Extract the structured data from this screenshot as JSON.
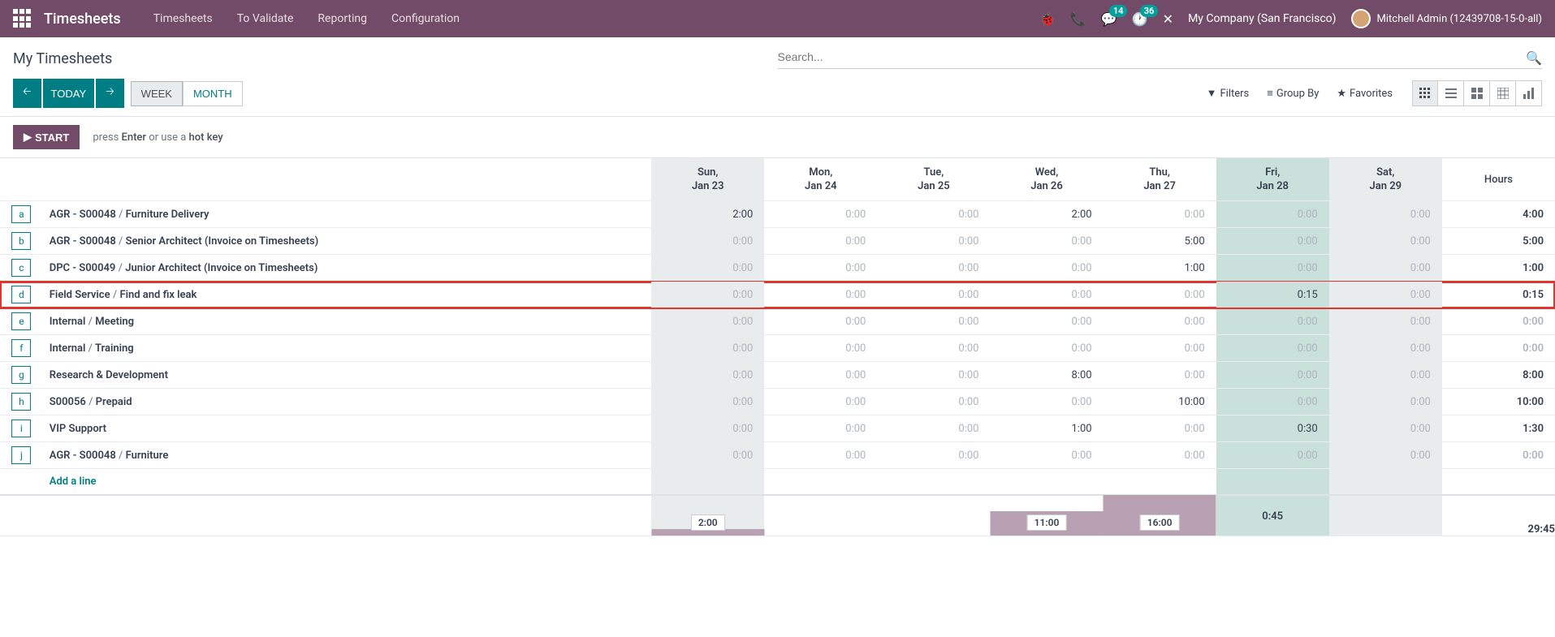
{
  "nav": {
    "brand": "Timesheets",
    "menu": [
      "Timesheets",
      "To Validate",
      "Reporting",
      "Configuration"
    ],
    "messaging_badge": "14",
    "activities_badge": "36",
    "company": "My Company (San Francisco)",
    "user": "Mitchell Admin (12439708-15-0-all)"
  },
  "breadcrumb": "My Timesheets",
  "search": {
    "placeholder": "Search..."
  },
  "today": "TODAY",
  "scales": {
    "week": "WEEK",
    "month": "MONTH"
  },
  "filters": "Filters",
  "groupby": "Group By",
  "favorites": "Favorites",
  "start": "START",
  "hint_prefix": "press ",
  "hint_enter": "Enter",
  "hint_mid": " or use a ",
  "hint_hotkey": "hot key",
  "days": [
    {
      "dow": "Sun,",
      "date": "Jan 23",
      "cls": "col-sun"
    },
    {
      "dow": "Mon,",
      "date": "Jan 24",
      "cls": ""
    },
    {
      "dow": "Tue,",
      "date": "Jan 25",
      "cls": ""
    },
    {
      "dow": "Wed,",
      "date": "Jan 26",
      "cls": ""
    },
    {
      "dow": "Thu,",
      "date": "Jan 27",
      "cls": ""
    },
    {
      "dow": "Fri,",
      "date": "Jan 28",
      "cls": "col-fri"
    },
    {
      "dow": "Sat,",
      "date": "Jan 29",
      "cls": "col-sat"
    }
  ],
  "hours_header": "Hours",
  "rows": [
    {
      "key": "a",
      "p1": "AGR - S00048",
      "p2": "Furniture Delivery",
      "cells": [
        "2:00",
        "0:00",
        "0:00",
        "2:00",
        "0:00",
        "0:00",
        "0:00"
      ],
      "total": "4:00",
      "hl": false
    },
    {
      "key": "b",
      "p1": "AGR - S00048",
      "p2": "Senior Architect (Invoice on Timesheets)",
      "cells": [
        "0:00",
        "0:00",
        "0:00",
        "0:00",
        "5:00",
        "0:00",
        "0:00"
      ],
      "total": "5:00",
      "hl": false
    },
    {
      "key": "c",
      "p1": "DPC - S00049",
      "p2": "Junior Architect (Invoice on Timesheets)",
      "cells": [
        "0:00",
        "0:00",
        "0:00",
        "0:00",
        "1:00",
        "0:00",
        "0:00"
      ],
      "total": "1:00",
      "hl": false
    },
    {
      "key": "d",
      "p1": "Field Service",
      "p2": "Find and fix leak",
      "cells": [
        "0:00",
        "0:00",
        "0:00",
        "0:00",
        "0:00",
        "0:15",
        "0:00"
      ],
      "total": "0:15",
      "hl": true
    },
    {
      "key": "e",
      "p1": "Internal",
      "p2": "Meeting",
      "cells": [
        "0:00",
        "0:00",
        "0:00",
        "0:00",
        "0:00",
        "0:00",
        "0:00"
      ],
      "total": "0:00",
      "hl": false
    },
    {
      "key": "f",
      "p1": "Internal",
      "p2": "Training",
      "cells": [
        "0:00",
        "0:00",
        "0:00",
        "0:00",
        "0:00",
        "0:00",
        "0:00"
      ],
      "total": "0:00",
      "hl": false
    },
    {
      "key": "g",
      "p1": "Research & Development",
      "p2": "",
      "cells": [
        "0:00",
        "0:00",
        "0:00",
        "8:00",
        "0:00",
        "0:00",
        "0:00"
      ],
      "total": "8:00",
      "hl": false
    },
    {
      "key": "h",
      "p1": "S00056",
      "p2": "Prepaid",
      "cells": [
        "0:00",
        "0:00",
        "0:00",
        "0:00",
        "10:00",
        "0:00",
        "0:00"
      ],
      "total": "10:00",
      "hl": false
    },
    {
      "key": "i",
      "p1": "VIP Support",
      "p2": "",
      "cells": [
        "0:00",
        "0:00",
        "0:00",
        "1:00",
        "0:00",
        "0:30",
        "0:00"
      ],
      "total": "1:30",
      "hl": false
    },
    {
      "key": "j",
      "p1": "AGR - S00048",
      "p2": "Furniture",
      "cells": [
        "0:00",
        "0:00",
        "0:00",
        "0:00",
        "0:00",
        "0:00",
        "0:00"
      ],
      "total": "0:00",
      "hl": false
    }
  ],
  "add_line": "Add a line",
  "footer": {
    "cells": [
      {
        "val": "2:00",
        "h": 8,
        "boxed": true
      },
      {
        "val": "",
        "h": 0,
        "boxed": false
      },
      {
        "val": "",
        "h": 0,
        "boxed": false
      },
      {
        "val": "11:00",
        "h": 30,
        "boxed": true
      },
      {
        "val": "16:00",
        "h": 50,
        "boxed": true
      },
      {
        "val": "0:45",
        "h": 0,
        "boxed": false
      },
      {
        "val": "",
        "h": 0,
        "boxed": false
      }
    ],
    "total": "29:45"
  }
}
